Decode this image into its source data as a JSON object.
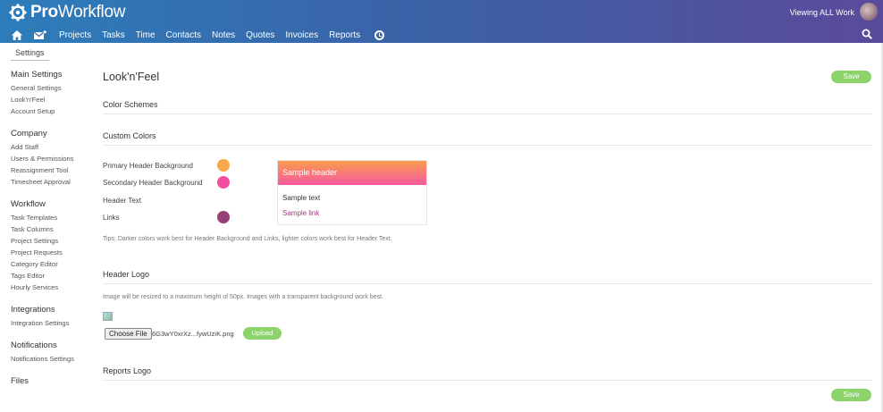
{
  "app": {
    "name_bold": "Pro",
    "name_rest": "Workflow",
    "viewing": "Viewing ALL Work",
    "colors": {
      "accent": "#8cd36b",
      "topbar_start": "#2d7dba",
      "topbar_end": "#5a4a9a"
    }
  },
  "nav": {
    "items": [
      "Projects",
      "Tasks",
      "Time",
      "Contacts",
      "Notes",
      "Quotes",
      "Invoices",
      "Reports"
    ],
    "icons": [
      "home-icon",
      "mail-icon",
      "clock-icon",
      "search-icon"
    ]
  },
  "breadcrumb": "Settings",
  "sidebar": {
    "groups": [
      {
        "title": "Main Settings",
        "links": [
          "General Settings",
          "Look'n'Feel",
          "Account Setup"
        ]
      },
      {
        "title": "Company",
        "links": [
          "Add Staff",
          "Users & Permissions",
          "Reassignment Tool",
          "Timesheet Approval"
        ]
      },
      {
        "title": "Workflow",
        "links": [
          "Task Templates",
          "Task Columns",
          "Project Settings",
          "Project Requests",
          "Category Editor",
          "Tags Editor",
          "Hourly Services"
        ]
      },
      {
        "title": "Integrations",
        "links": [
          "Integration Settings"
        ]
      },
      {
        "title": "Notifications",
        "links": [
          "Notifications Settings"
        ]
      },
      {
        "title": "Files",
        "links": []
      }
    ]
  },
  "main": {
    "title": "Look'n'Feel",
    "save_label": "Save",
    "sections": {
      "color_schemes": "Color Schemes",
      "custom_colors": "Custom Colors",
      "header_logo": "Header Logo",
      "reports_logo": "Reports Logo"
    },
    "custom_colors": [
      {
        "label": "Primary Header Background",
        "color": "#f9a94b"
      },
      {
        "label": "Secondary Header Background",
        "color": "#f34f9f"
      },
      {
        "label": "Header Text",
        "color": "#ffffff"
      },
      {
        "label": "Links",
        "color": "#983f76"
      }
    ],
    "sample": {
      "header": "Sample header",
      "text": "Sample text",
      "link": "Sample link"
    },
    "tips": "Tips: Darker colors work best for Header Background and Links, lighter colors work best for Header Text.",
    "logo_note": "Image will be resized to a maximum height of 50px. Images with a transparent background work best.",
    "choose_file": "Choose File",
    "file_name": "6G3wY0xrXz...fywUziK.png",
    "upload_label": "Upload"
  }
}
